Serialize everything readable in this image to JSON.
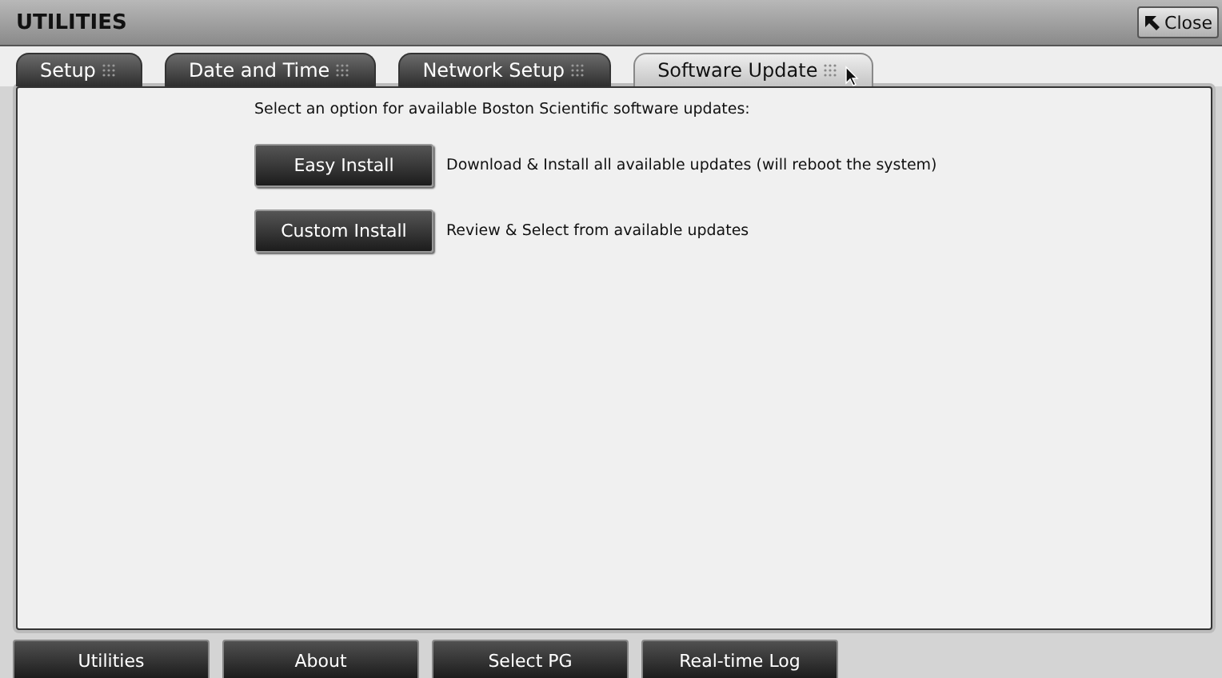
{
  "window": {
    "title": "UTILITIES",
    "close_label": "Close"
  },
  "tabs": [
    {
      "label": "Setup",
      "selected": false
    },
    {
      "label": "Date and Time",
      "selected": false
    },
    {
      "label": "Network Setup",
      "selected": false
    },
    {
      "label": "Software Update",
      "selected": true
    }
  ],
  "panel": {
    "prompt": "Select an option for available Boston Scientific software updates:",
    "options": [
      {
        "button": "Easy Install",
        "description": "Download & Install all available updates (will reboot the system)"
      },
      {
        "button": "Custom Install",
        "description": "Review & Select from available updates"
      }
    ]
  },
  "bottom_nav": [
    "Utilities",
    "About",
    "Select PG",
    "Real-time Log"
  ]
}
